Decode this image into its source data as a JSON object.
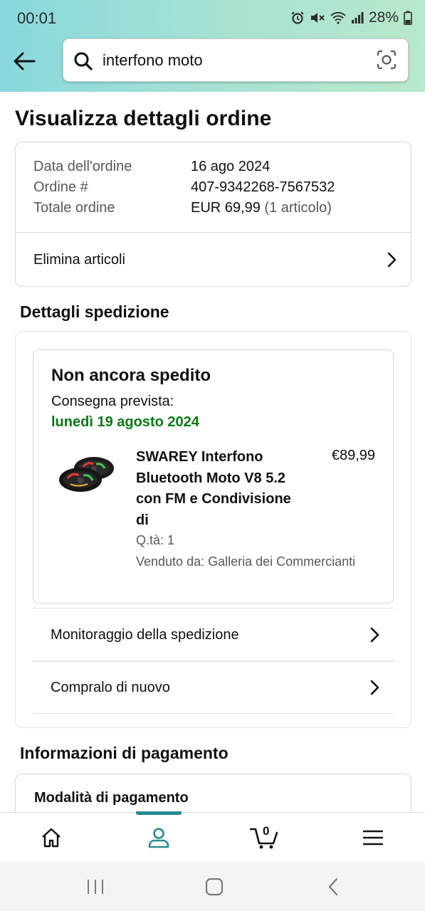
{
  "status_bar": {
    "time": "00:01",
    "battery": "28%",
    "icons": [
      "alarm-icon",
      "mute-icon",
      "wifi-icon",
      "signal-icon",
      "battery-icon"
    ]
  },
  "search": {
    "query": "interfono moto",
    "icons": [
      "back-arrow-icon",
      "search-icon",
      "camera-scan-icon"
    ]
  },
  "page_title": "Visualizza dettagli ordine",
  "order": {
    "date_label": "Data dell'ordine",
    "date_value": "16 ago 2024",
    "number_label": "Ordine #",
    "number_value": "407-9342268-7567532",
    "total_label": "Totale ordine",
    "total_value": "EUR 69,99",
    "total_items": "(1 articolo)",
    "delete_items": "Elimina articoli"
  },
  "shipping": {
    "section_title": "Dettagli spedizione",
    "status": "Non ancora spedito",
    "expected_label": "Consegna prevista:",
    "expected_date": "lunedì 19 agosto 2024",
    "product": {
      "title": "SWAREY Interfono Bluetooth Moto V8 5.2 con FM e Condivisione di",
      "price": "€89,99",
      "qty": "Q.tà: 1",
      "seller": "Venduto da: Galleria dei Commercianti"
    },
    "track": "Monitoraggio della spedizione",
    "buy_again": "Compralo di nuovo"
  },
  "payment": {
    "section_title": "Informazioni di pagamento",
    "method_label": "Modalità di pagamento"
  },
  "bottom_nav": {
    "cart_count": "0",
    "items": [
      "home-icon",
      "account-icon",
      "cart-icon",
      "menu-icon"
    ]
  },
  "colors": {
    "accent_teal": "#2b8a8f",
    "delivery_green": "#087b13",
    "header_gradient_start": "#88d8de",
    "header_gradient_end": "#b9e8cc"
  }
}
